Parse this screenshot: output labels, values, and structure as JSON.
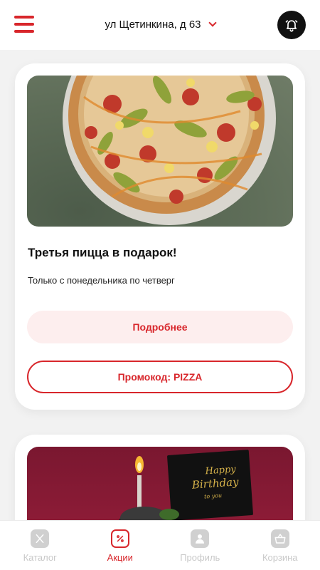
{
  "header": {
    "address": "ул Щетинкина, д 63"
  },
  "promos": [
    {
      "title": "Третья пицца в подарок!",
      "subtitle": "Только с понедельника по четверг",
      "more_label": "Подробнее",
      "promo_label": "Промокод: PIZZA"
    }
  ],
  "cake_card": {
    "card_text_line1": "Happy",
    "card_text_line2": "Birthday",
    "card_text_line3": "to you"
  },
  "tabbar": {
    "items": [
      {
        "label": "Каталог",
        "icon": "utensils-icon",
        "active": false
      },
      {
        "label": "Акции",
        "icon": "discount-icon",
        "active": true
      },
      {
        "label": "Профиль",
        "icon": "profile-icon",
        "active": false
      },
      {
        "label": "Корзина",
        "icon": "basket-icon",
        "active": false
      }
    ]
  },
  "colors": {
    "accent": "#d8262b",
    "inactive": "#c9c9c9"
  }
}
